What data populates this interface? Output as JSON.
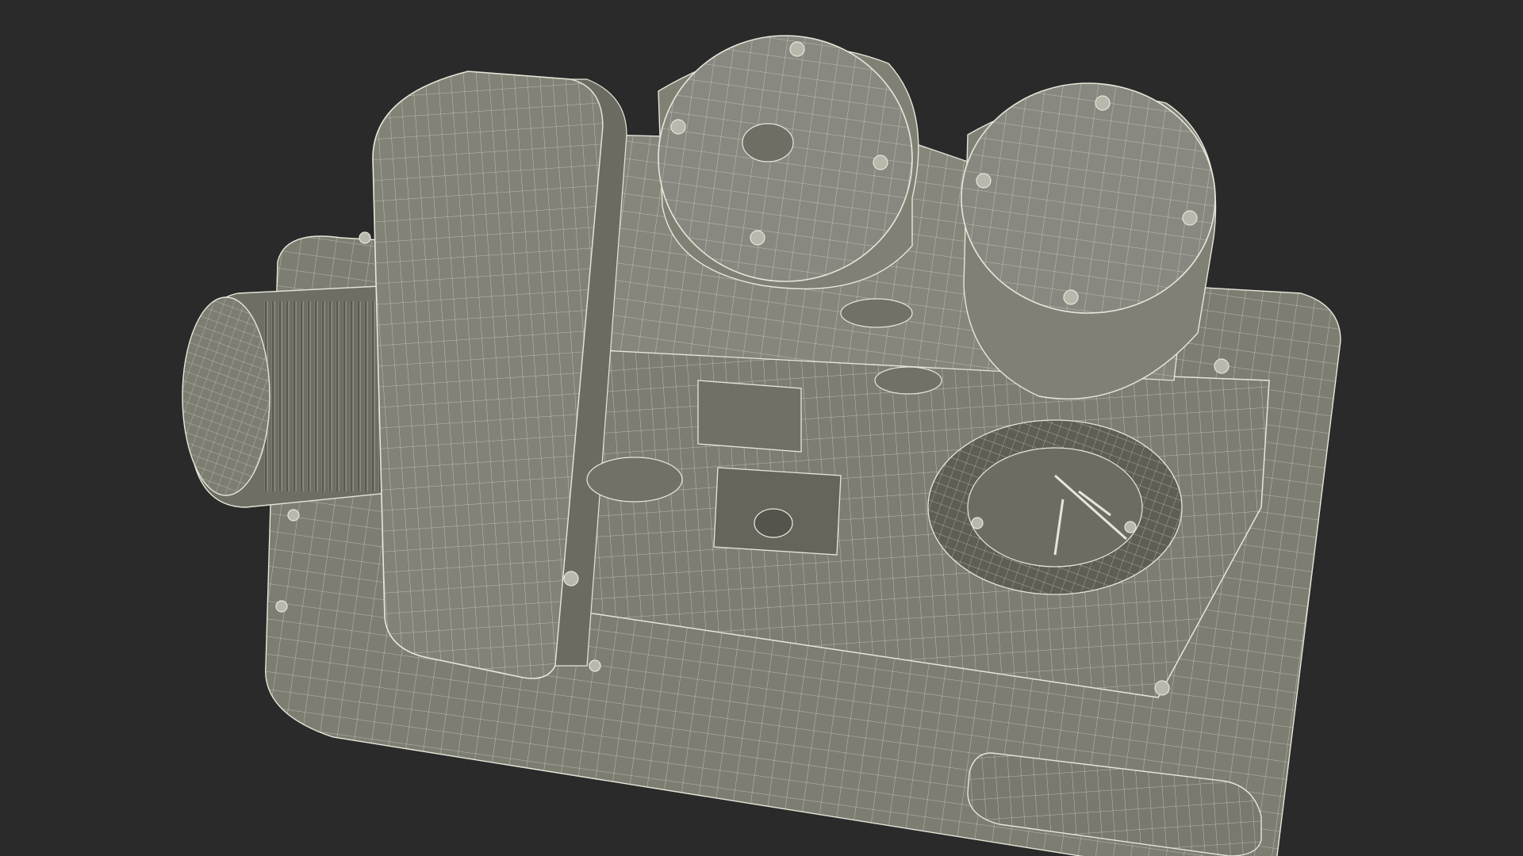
{
  "scene": {
    "background": "#2a2a2a",
    "model_fill": "#7e7d72",
    "model_fill_dark": "#66655c",
    "model_fill_light": "#8f8e83",
    "wire_color": "#e6e6da",
    "subject": "wireframe-machine-model"
  }
}
